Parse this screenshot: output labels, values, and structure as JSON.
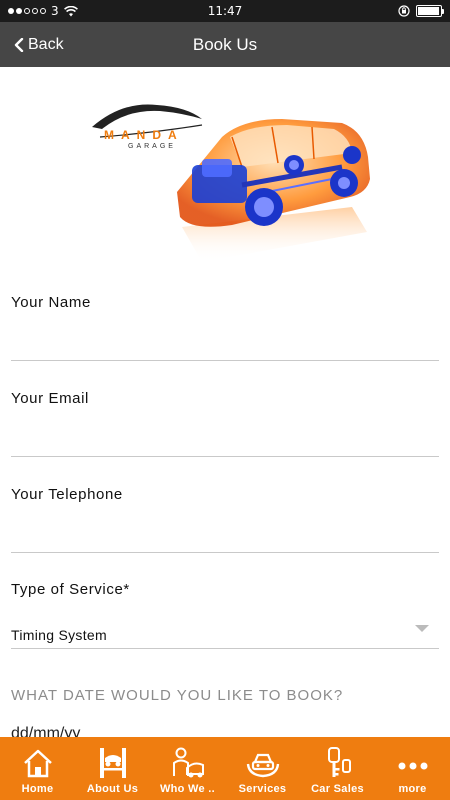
{
  "status_bar": {
    "carrier": "3",
    "time": "11:47",
    "battery_level": 0.95
  },
  "nav": {
    "back_label": "Back",
    "title": "Book Us"
  },
  "hero": {
    "logo_text": "MANDA",
    "logo_subtext": "GARAGE"
  },
  "form": {
    "name_label": "Your Name",
    "name_value": "",
    "email_label": "Your Email",
    "email_value": "",
    "telephone_label": "Your Telephone",
    "telephone_value": "",
    "service_label": "Type of Service*",
    "service_value": "Timing System",
    "date_question": "WHAT DATE WOULD YOU LIKE TO BOOK?",
    "date_placeholder": "dd/mm/yy"
  },
  "tabs": [
    {
      "label": "Home",
      "icon": "home-icon"
    },
    {
      "label": "About Us",
      "icon": "lift-icon"
    },
    {
      "label": "Who We ..",
      "icon": "mechanic-icon"
    },
    {
      "label": "Services",
      "icon": "car-hands-icon"
    },
    {
      "label": "Car Sales",
      "icon": "car-key-icon"
    },
    {
      "label": "more",
      "icon": "more-dots-icon"
    }
  ],
  "colors": {
    "accent": "#ef7d10",
    "nav_bg": "#464646"
  }
}
